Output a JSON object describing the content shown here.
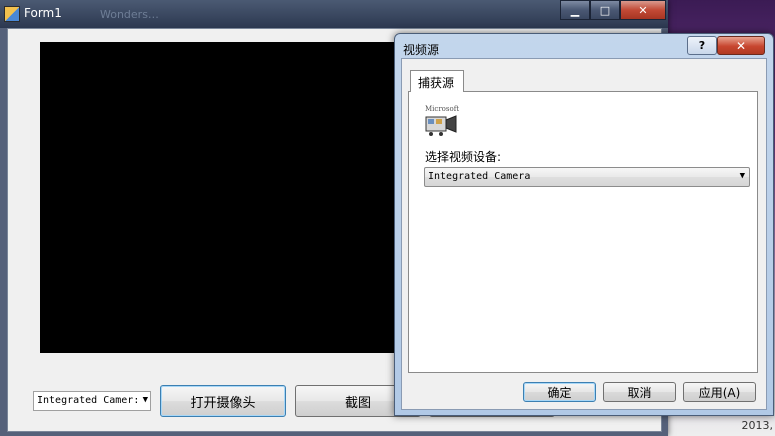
{
  "form1": {
    "title": "Form1",
    "background_tab": "Wonders…",
    "caption_buttons": {
      "minimize": "▁",
      "maximize": "□",
      "close": "✕"
    },
    "camera_combo_value": "Integrated Camer:",
    "buttons": {
      "open_camera": "打开摄像头",
      "screenshot": "截图"
    }
  },
  "dialog": {
    "title": "视频源",
    "help": "?",
    "close": "✕",
    "tab": "捕获源",
    "logo_text": "Microsoft",
    "device_label": "选择视频设备:",
    "device_value": "Integrated Camera",
    "buttons": {
      "ok": "确定",
      "cancel": "取消",
      "apply": "应用(A)"
    }
  },
  "desktop": {
    "year_fragment": "2013,"
  },
  "icons": [
    "app-icon",
    "camera-icon",
    "dropdown-arrow-icon"
  ],
  "colors": {
    "accent_focus": "#3c7fb1",
    "close_red": "#c7462f",
    "video_bg": "#000000"
  }
}
